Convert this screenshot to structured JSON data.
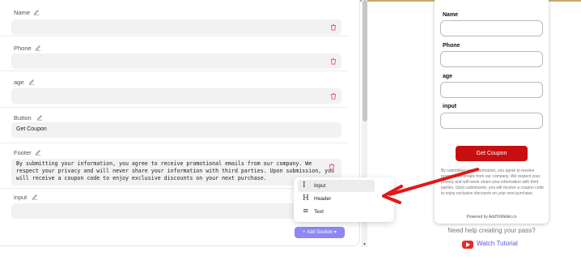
{
  "editor": {
    "sections": [
      {
        "label": "Name",
        "value": ""
      },
      {
        "label": "Phone",
        "value": ""
      },
      {
        "label": "age",
        "value": ""
      },
      {
        "label": "Button",
        "value": "Get Coupon"
      },
      {
        "label": "Footer",
        "value": "By submitting your information, you agree to receive promotional emails from our company. We respect your privacy and will never share your information with third parties. Upon submission, you will receive a coupon code to enjoy exclusive discounts on your next purchase."
      },
      {
        "label": "input",
        "value": ""
      }
    ],
    "add_section_label": "+ Add Section",
    "add_section_caret": "▾"
  },
  "dropdown": {
    "items": [
      {
        "label": "Input",
        "icon": "text-cursor-icon",
        "glyph": "I"
      },
      {
        "label": "Header",
        "icon": "heading-icon",
        "glyph": "H"
      },
      {
        "label": "Text",
        "icon": "text-align-icon",
        "glyph": "≡"
      }
    ]
  },
  "preview": {
    "fields": [
      "Name",
      "Phone",
      "age",
      "input"
    ],
    "button_label": "Get Coupon",
    "footer_text": "By submitting your information, you agree to receive promotional emails from our company. We respect your privacy and will never share your information with third parties. Upon submission, you will receive a coupon code to enjoy exclusive discounts on your next purchase.",
    "powered_by": "Powered by AddToWallet.co"
  },
  "help": {
    "question": "Need help creating your pass?",
    "watch_label": "Watch Tutorial"
  },
  "colors": {
    "accent": "#8f87f3",
    "brand_red": "#c80f0f",
    "link": "#5b55e6",
    "annotation_arrow": "#e01818"
  }
}
